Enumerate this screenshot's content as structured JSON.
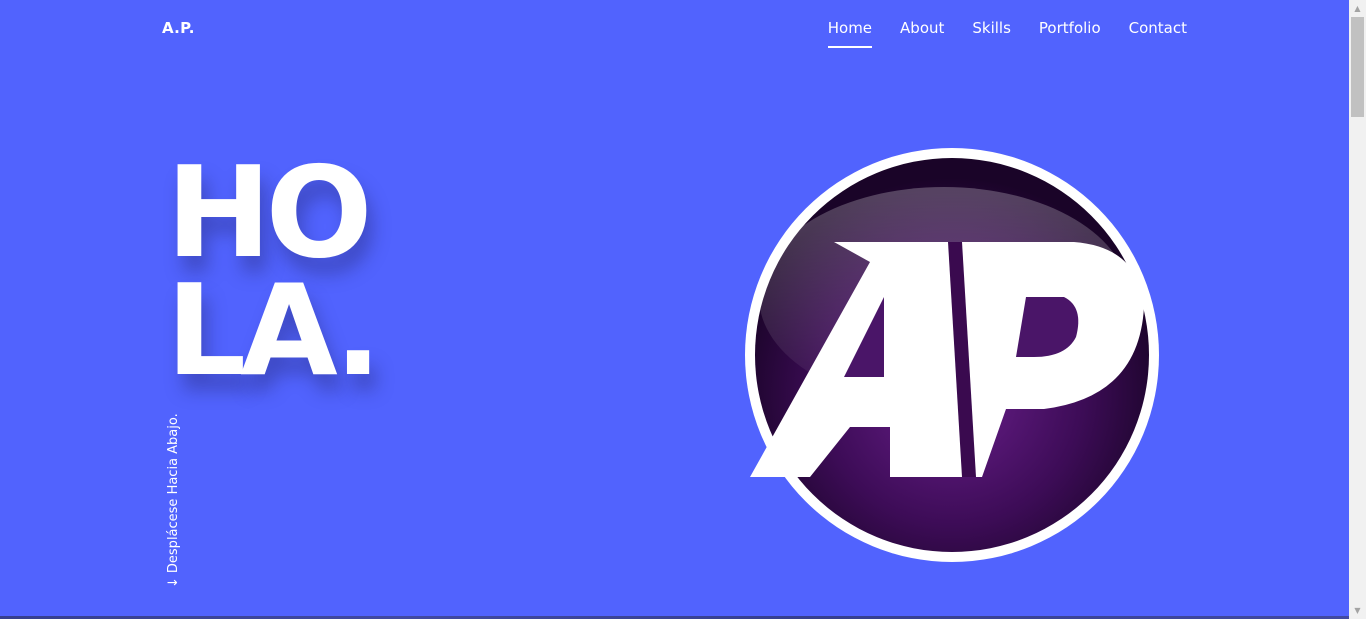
{
  "header": {
    "brand": "A.P.",
    "nav": [
      {
        "label": "Home",
        "active": true
      },
      {
        "label": "About",
        "active": false
      },
      {
        "label": "Skills",
        "active": false
      },
      {
        "label": "Portfolio",
        "active": false
      },
      {
        "label": "Contact",
        "active": false
      }
    ]
  },
  "hero": {
    "line1": "HO",
    "line2": "LA.",
    "scroll_hint": "Desplácese Hacia Abajo.",
    "scroll_arrow": "↓"
  },
  "logo": {
    "text": "AP",
    "ring_color": "#ffffff",
    "inner_color": "#3a0a4f"
  },
  "colors": {
    "background": "#5163fe",
    "text": "#ffffff"
  },
  "scrollbar": {
    "up_icon": "▲",
    "down_icon": "▼"
  }
}
